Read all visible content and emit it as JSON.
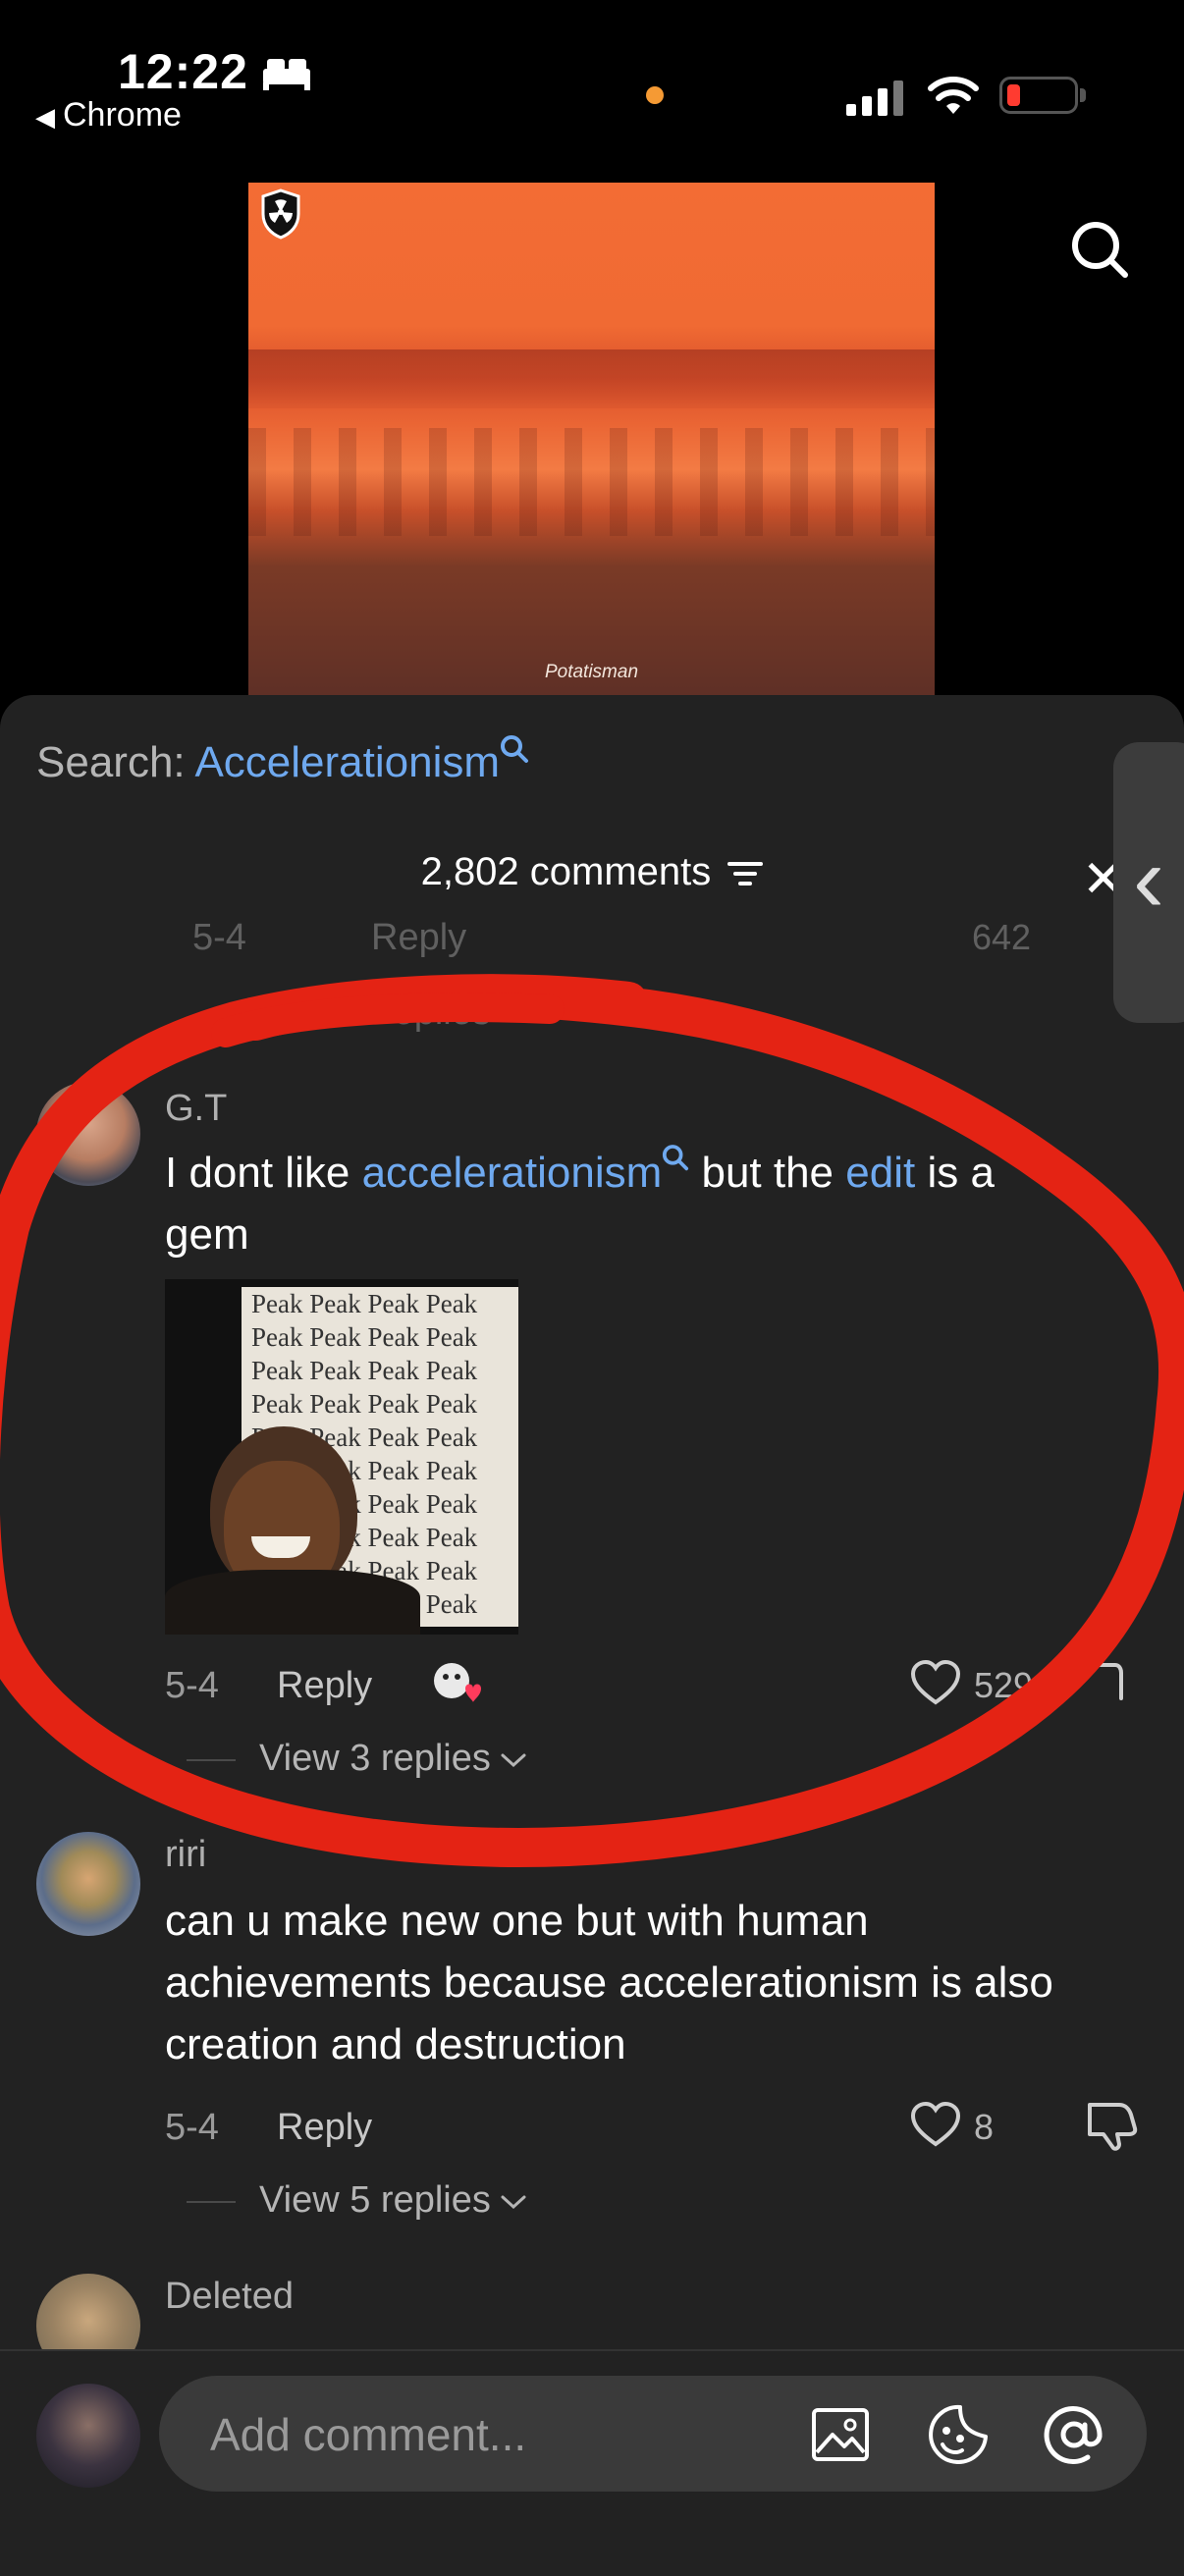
{
  "status_bar": {
    "time": "12:22",
    "back_app": "Chrome",
    "accent": "#f59a34",
    "battery_color": "#ff3b30"
  },
  "video": {
    "watermark": "Potatisman"
  },
  "search": {
    "prefix": "Search: ",
    "term": "Accelerationism"
  },
  "comments_header": {
    "count_label": "2,802 comments"
  },
  "prev_comment": {
    "date": "5-4",
    "reply": "Reply",
    "likes": "642",
    "view_replies": "View 2 replies"
  },
  "comments": [
    {
      "username": "G.T",
      "text_parts": [
        "I dont like ",
        "accelerationism",
        " but the ",
        "edit",
        " is a"
      ],
      "text_line2": "gem",
      "gif_text": "Peak",
      "date": "5-4",
      "reply": "Reply",
      "likes": "529",
      "view_replies": "View 3 replies"
    },
    {
      "username": "riri",
      "text": "can u make new one but with human achievements because accelerationism is also creation and destruction",
      "date": "5-4",
      "reply": "Reply",
      "likes": "8",
      "view_replies": "View 5 replies"
    },
    {
      "username": "Deleted"
    }
  ],
  "input": {
    "placeholder": "Add comment..."
  },
  "icons": [
    "radiation-shield-icon",
    "search-icon",
    "filter-icon",
    "close-icon",
    "chevron-left-icon",
    "heart-icon",
    "dislike-icon",
    "chevron-down-icon",
    "image-icon",
    "emoji-icon",
    "at-icon"
  ],
  "colors": {
    "link": "#6fa9ef",
    "sheet_bg": "#222222",
    "annotation_red": "#e42314"
  }
}
